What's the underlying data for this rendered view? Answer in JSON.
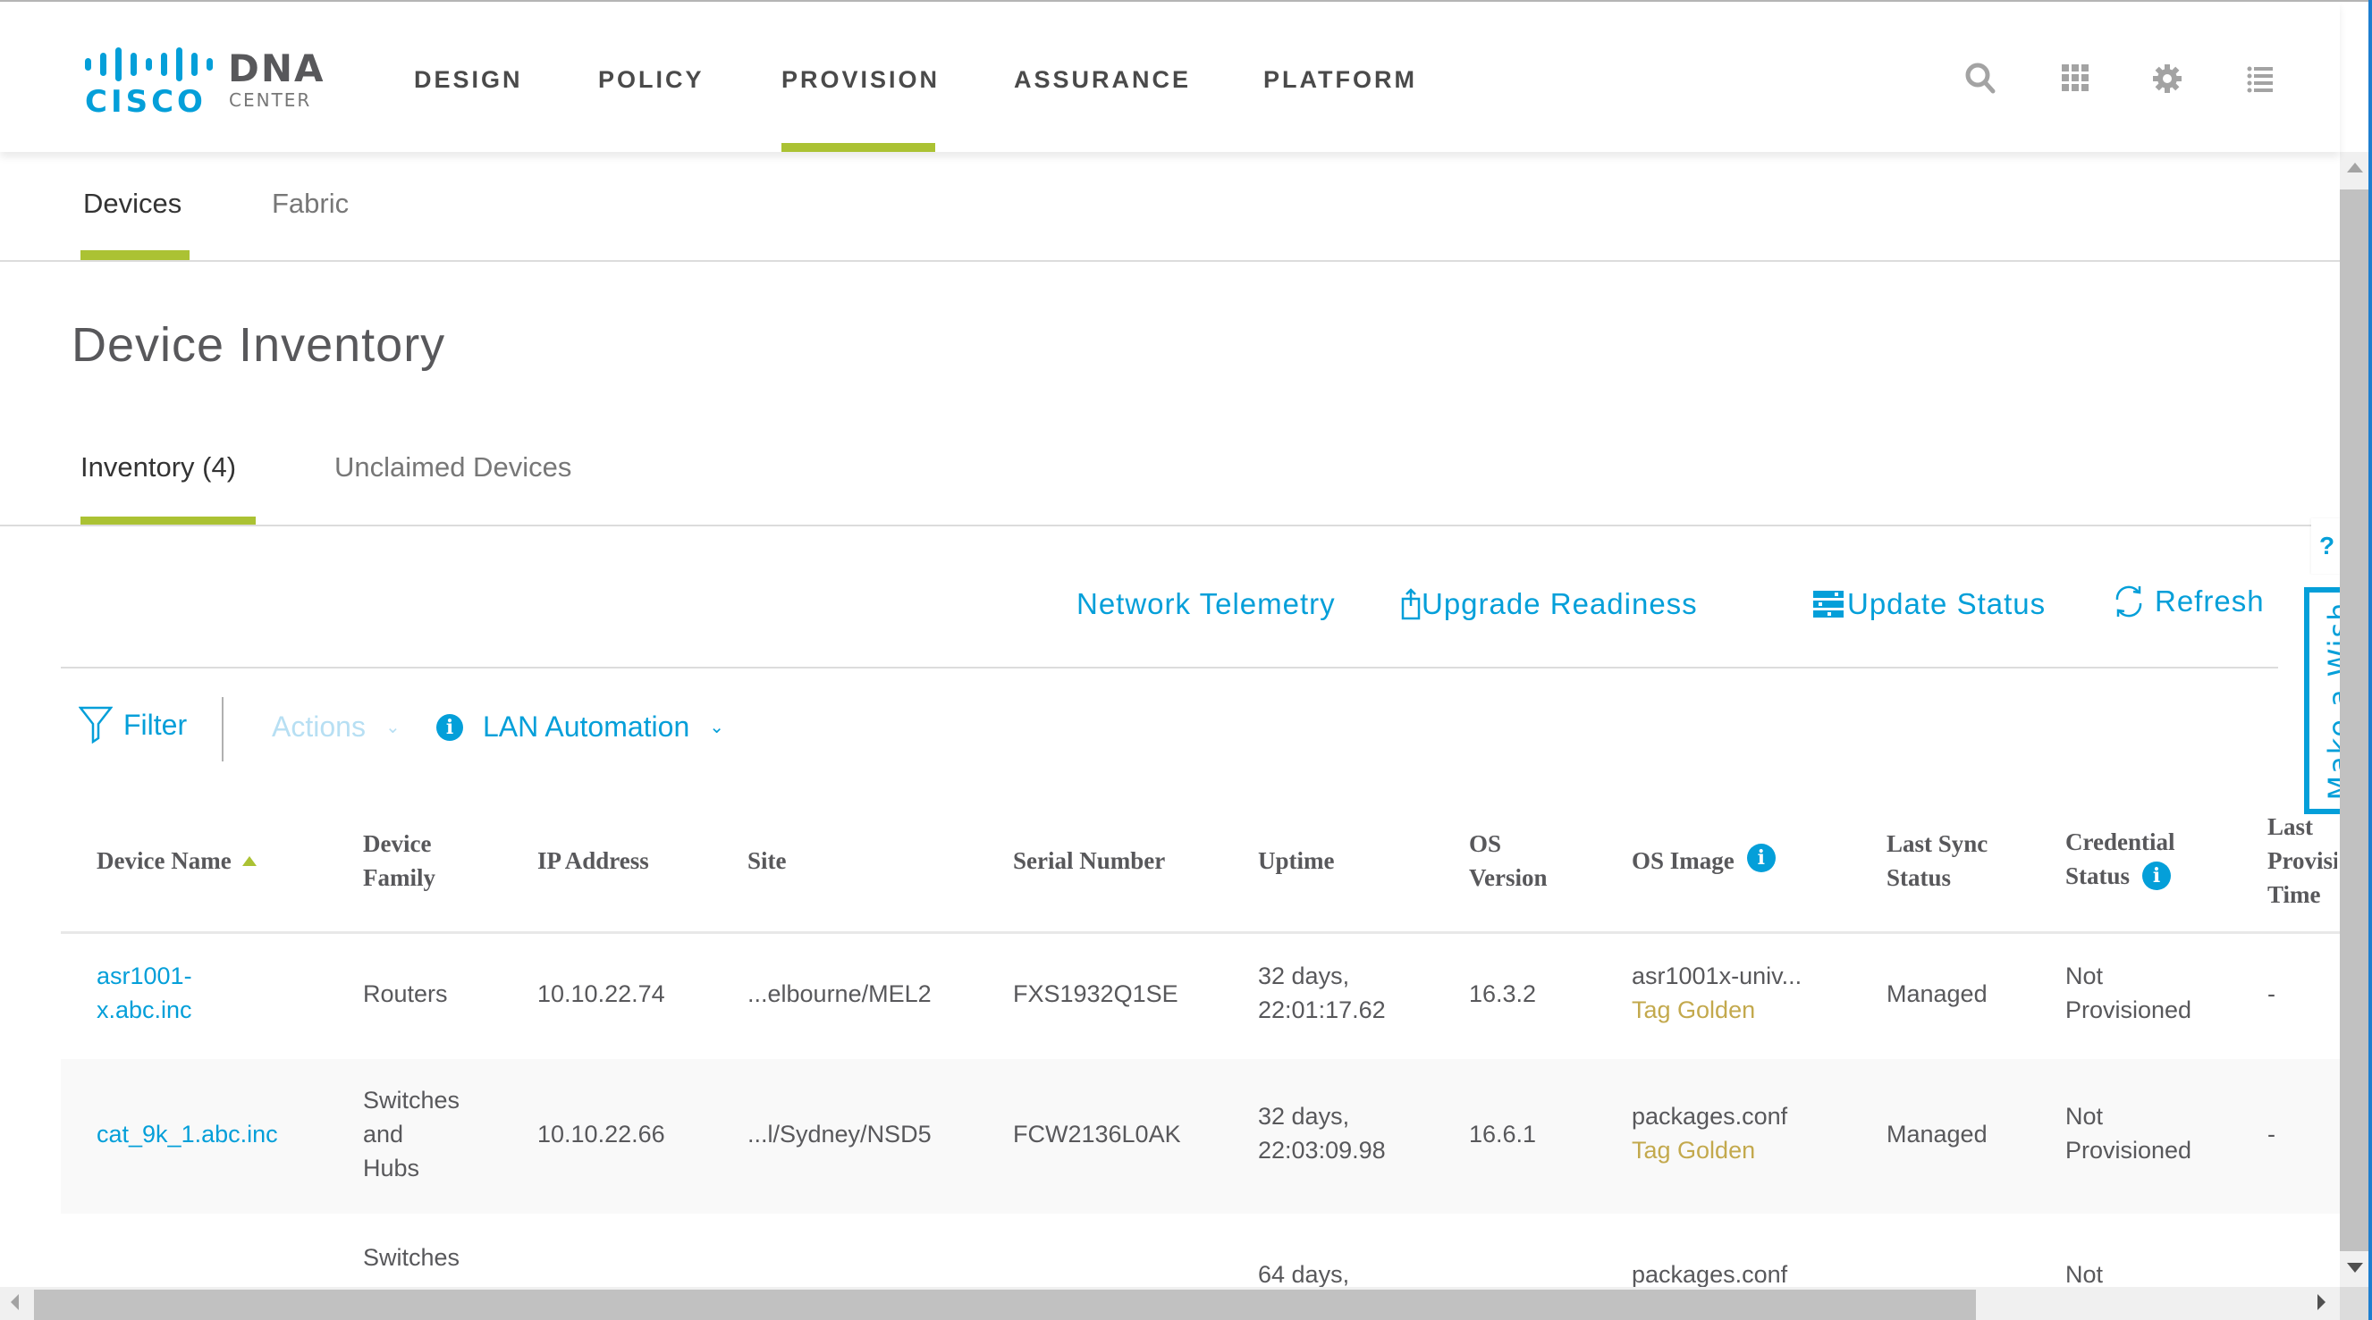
{
  "brand": {
    "logo_text": "CISCO",
    "product": "DNA",
    "product_sub": "CENTER",
    "logo_color": "#049fd9"
  },
  "nav": {
    "items": [
      {
        "label": "DESIGN",
        "active": false
      },
      {
        "label": "POLICY",
        "active": false
      },
      {
        "label": "PROVISION",
        "active": true
      },
      {
        "label": "ASSURANCE",
        "active": false
      },
      {
        "label": "PLATFORM",
        "active": false
      }
    ],
    "icons": [
      "search-icon",
      "apps-grid-icon",
      "gear-icon",
      "list-icon"
    ],
    "accent_color": "#abc233"
  },
  "subtabs": [
    {
      "label": "Devices",
      "active": true
    },
    {
      "label": "Fabric",
      "active": false
    }
  ],
  "page_title": "Device Inventory",
  "inventory_tabs": [
    {
      "label": "Inventory  (4)",
      "active": true
    },
    {
      "label": "Unclaimed Devices",
      "active": false
    }
  ],
  "actions_bar": {
    "network_telemetry": "Network Telemetry",
    "upgrade_readiness": "Upgrade Readiness",
    "update_status": "Update Status",
    "refresh": "Refresh"
  },
  "toolbar": {
    "filter": "Filter",
    "actions": "Actions",
    "lan_automation": "LAN Automation",
    "info_glyph": "i"
  },
  "table": {
    "columns": [
      {
        "label": "Device Name",
        "sorted": "asc"
      },
      {
        "label": "Device Family"
      },
      {
        "label": "IP Address"
      },
      {
        "label": "Site"
      },
      {
        "label": "Serial Number"
      },
      {
        "label": "Uptime"
      },
      {
        "label": "OS Version"
      },
      {
        "label": "OS Image",
        "info": true
      },
      {
        "label": "Last Sync Status"
      },
      {
        "label": "Credential Status",
        "info": true
      },
      {
        "label": "Last Provisi Time"
      }
    ],
    "header_lines": {
      "device_name": "Device Name",
      "family_1": "Device",
      "family_2": "Family",
      "ip": "IP Address",
      "site": "Site",
      "serial": "Serial Number",
      "uptime": "Uptime",
      "osv_1": "OS",
      "osv_2": "Version",
      "osimg": "OS Image",
      "sync_1": "Last Sync",
      "sync_2": "Status",
      "cred_1": "Credential",
      "cred_2": "Status",
      "lpt_1": "Last",
      "lpt_2": "Provisi",
      "lpt_3": "Time"
    },
    "rows": [
      {
        "device_name_1": "asr1001-",
        "device_name_2": "x.abc.inc",
        "family": "Routers",
        "ip": "10.10.22.74",
        "site": "...elbourne/MEL2",
        "serial": "FXS1932Q1SE",
        "uptime_1": "32 days,",
        "uptime_2": "22:01:17.62",
        "os_version": "16.3.2",
        "os_image": "asr1001x-univ...",
        "os_tag": "Tag Golden",
        "sync": "Managed",
        "cred_1": "Not",
        "cred_2": "Provisioned",
        "last_prov": "-"
      },
      {
        "device_name_1": "cat_9k_1.abc.inc",
        "family_1": "Switches",
        "family_2": "and",
        "family_3": "Hubs",
        "ip": "10.10.22.66",
        "site": "...l/Sydney/NSD5",
        "serial": "FCW2136L0AK",
        "uptime_1": "32 days,",
        "uptime_2": "22:03:09.98",
        "os_version": "16.6.1",
        "os_image": "packages.conf",
        "os_tag": "Tag Golden",
        "sync": "Managed",
        "cred_1": "Not",
        "cred_2": "Provisioned",
        "last_prov": "-"
      },
      {
        "family_1": "Switches",
        "uptime_1": "64 days,",
        "os_image": "packages.conf",
        "cred_1": "Not"
      }
    ]
  },
  "side": {
    "help": "?",
    "make_a_wish": "Make a Wish"
  }
}
